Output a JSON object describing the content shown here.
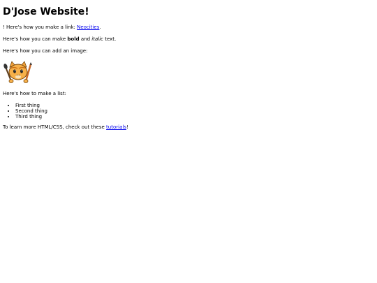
{
  "page": {
    "title": "D'Jose Website!",
    "link_line": {
      "prefix": "! Here's how you make a link: ",
      "link_text": "Neocities",
      "suffix": "."
    },
    "format_line": {
      "prefix": "Here's how you can make ",
      "bold_text": "bold",
      "middle": " and ",
      "italic_text": "italic",
      "suffix": " text."
    },
    "image_line": "Here's how you can add an image:",
    "image_alt": "cat mascot with brush and pencil",
    "list_intro": "Here's how to make a list:",
    "list_items": [
      "First thing",
      "Second thing",
      "Third thing"
    ],
    "tutorial_line": {
      "prefix": "To learn more HTML/CSS, check out these ",
      "link_text": "tutorials",
      "suffix": "!"
    }
  },
  "colors": {
    "link": "#0000ee",
    "text": "#000000",
    "background": "#ffffff"
  }
}
